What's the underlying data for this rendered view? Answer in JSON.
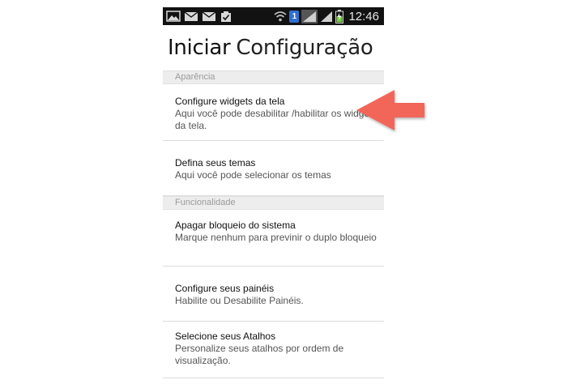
{
  "status_bar": {
    "time": "12:46",
    "sim_badge": "1",
    "left_icons": [
      "gallery-icon",
      "mail-icon",
      "mail-icon",
      "task-check-icon"
    ],
    "right_icons": [
      "wifi-icon",
      "sim-badge",
      "signal-icon",
      "signal-icon",
      "battery-charging-icon"
    ]
  },
  "header": {
    "title_bold": "Iniciar",
    "title_light": "Configuração"
  },
  "sections": [
    {
      "title": "Aparência",
      "items": [
        {
          "title": "Configure widgets da tela",
          "subtitle": "Aqui você pode desabilitar /habilitar os widgets da tela."
        },
        {
          "title": "Defina seus temas",
          "subtitle": "Aqui você pode selecionar os temas"
        }
      ]
    },
    {
      "title": "Funcionalidade",
      "items": [
        {
          "title": "Apagar bloqueio do sistema",
          "subtitle": "Marque nenhum para previnir o duplo bloqueio"
        },
        {
          "title": "Configure seus painéis",
          "subtitle": "Habilite ou Desabilite Painéis."
        },
        {
          "title": "Selecione seus Atalhos",
          "subtitle": "Personalize seus atalhos por ordem de visualização."
        }
      ]
    }
  ],
  "colors": {
    "status_bar_bg": "#121212",
    "section_header_bg": "#ededed",
    "arrow": "#f2665a",
    "sim_badge": "#2f6fd1"
  }
}
